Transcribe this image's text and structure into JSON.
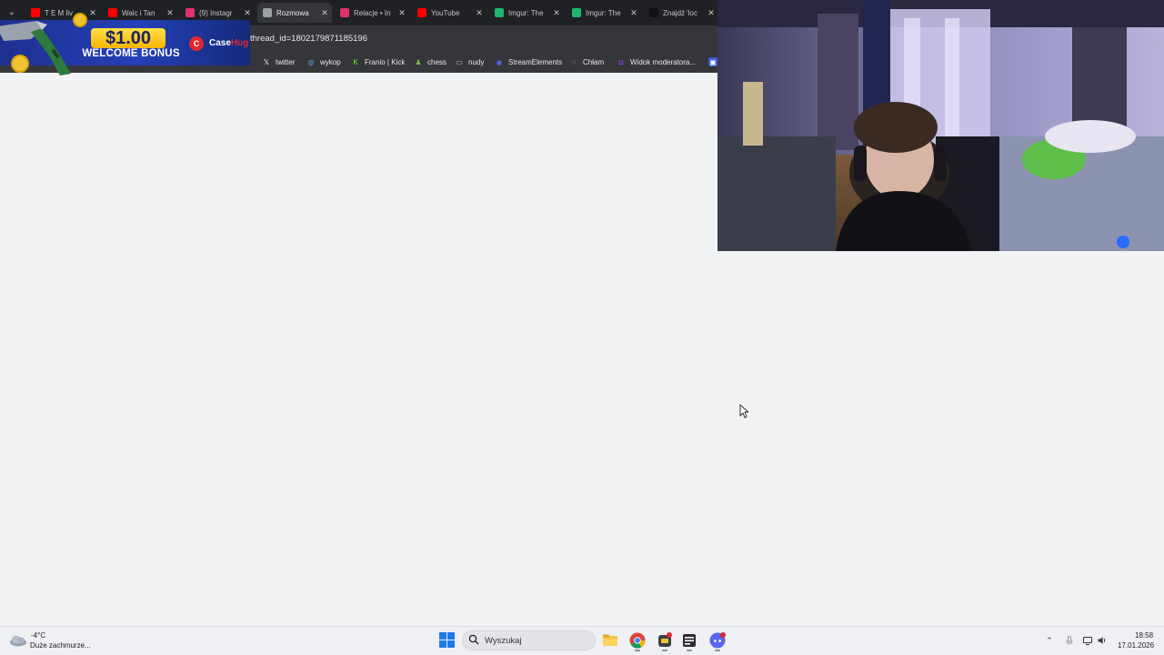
{
  "browser": {
    "tabs": [
      {
        "label": "T E M liv",
        "favicon": "youtube-icon",
        "color": "#ff0000"
      },
      {
        "label": "Walc i Tan",
        "favicon": "youtube-icon",
        "color": "#ff0000"
      },
      {
        "label": "(9) Instagr",
        "favicon": "instagram-icon",
        "color": "#e1306c"
      },
      {
        "label": "Rozmowa",
        "favicon": "messenger-icon",
        "color": "#9aa0a6"
      },
      {
        "label": "Relacje • In",
        "favicon": "instagram-icon",
        "color": "#e1306c"
      },
      {
        "label": "YouTube",
        "favicon": "youtube-icon",
        "color": "#ff0000"
      },
      {
        "label": "Imgur: The",
        "favicon": "imgur-icon",
        "color": "#1bb76e"
      },
      {
        "label": "Imgur: The",
        "favicon": "imgur-icon",
        "color": "#1bb76e"
      },
      {
        "label": "Znajdź 'loc",
        "favicon": "tiktok-icon",
        "color": "#111111"
      }
    ],
    "active_tab": 3,
    "url_fragment": "thread_id=1802179871185196",
    "bookmarks": [
      {
        "label": "twitter",
        "icon": "x-icon",
        "color": "#ffffff"
      },
      {
        "label": "wykop",
        "icon": "wykop-icon",
        "color": "#5c8ed8"
      },
      {
        "label": "Franio | Kick",
        "icon": "kick-icon",
        "color": "#53fc18"
      },
      {
        "label": "chess",
        "icon": "chess-pawn-icon",
        "color": "#81b64c"
      },
      {
        "label": "nudy",
        "icon": "folder-icon",
        "color": "#c4c7c5"
      },
      {
        "label": "StreamElements",
        "icon": "streamelements-icon",
        "color": "#5865f2"
      },
      {
        "label": "Chłam",
        "icon": "globe-icon",
        "color": "#c4c7c5"
      },
      {
        "label": "Widok moderatora...",
        "icon": "twitch-icon",
        "color": "#9146ff"
      }
    ]
  },
  "ad": {
    "amount": "$1.00",
    "headline": "WELCOME BONUS",
    "brand_main": "Case",
    "brand_accent": "Hug"
  },
  "taskbar": {
    "weather": {
      "temp": "-4°C",
      "description": "Duże zachmurze..."
    },
    "search_placeholder": "Wyszukaj",
    "apps": [
      "file-explorer-icon",
      "chrome-icon",
      "game-launcher-icon",
      "notes-icon",
      "discord-icon"
    ],
    "tray": [
      "chevron-up-icon",
      "microphone-icon",
      "display-icon",
      "speaker-icon"
    ],
    "time": "18:58",
    "date": "17.01.2026"
  }
}
